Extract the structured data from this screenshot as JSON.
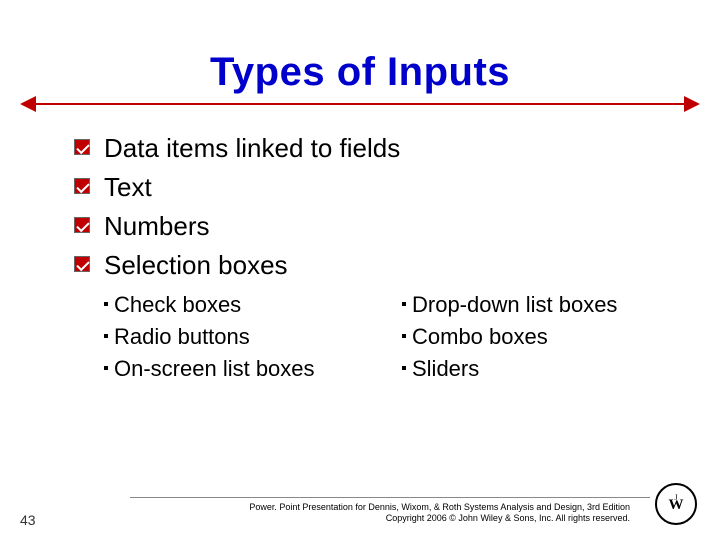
{
  "title": "Types of Inputs",
  "bullets": [
    "Data items linked to fields",
    "Text",
    "Numbers",
    "Selection boxes"
  ],
  "sub_left": [
    "Check boxes",
    "Radio buttons",
    "On-screen list boxes"
  ],
  "sub_right": [
    "Drop-down list boxes",
    "Combo boxes",
    "Sliders"
  ],
  "footer": {
    "line1": "Power. Point Presentation for Dennis, Wixom, & Roth Systems Analysis and Design, 3rd Edition",
    "line2": "Copyright 2006 © John Wiley & Sons, Inc.  All rights reserved."
  },
  "page_number": "43"
}
